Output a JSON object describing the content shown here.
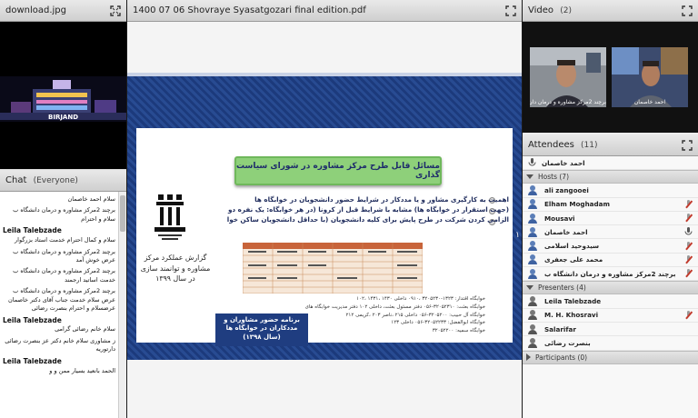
{
  "image_pod": {
    "title": "download.jpg",
    "caption": "BIRJAND"
  },
  "chat": {
    "title": "Chat",
    "audience": "(Everyone)",
    "messages": [
      {
        "author": "",
        "text": "سلام احمد خاصمان"
      },
      {
        "author": "",
        "text": "برچند 2مرکز مشاوره و درمان دانشگاه ب"
      },
      {
        "author": "",
        "text": "سلام و احترام"
      },
      {
        "author": "Leila Talebzade",
        "text": "سلام و کمال احترام خدمت استاد بزرگوار"
      },
      {
        "author": "",
        "text": "برچند 2مرکز مشاوره و درمان دانشگاه ب عرض خوش آمد"
      },
      {
        "author": "",
        "text": "برچند 2مرکز مشاوره و درمان دانشگاه ب خدمت اساتید ارجمند"
      },
      {
        "author": "",
        "text": "برچند 2مرکز مشاوره و درمان دانشگاه ب عرض سلام خدمت جناب آقای دکتر خاصمان"
      },
      {
        "author": "",
        "text": "عرضسلام و احترام بنصرت رضائی"
      },
      {
        "author": "Leila Talebzade",
        "text": "سلام خانم رضائی گرامی"
      },
      {
        "author": "",
        "text": "ز مشاوری سلام خانم دکتر عز بنصرت رضائی دارتوریه"
      },
      {
        "author": "Leila Talebzade",
        "text": "الحمد بانعید بسیار ممن و و"
      }
    ]
  },
  "share": {
    "title": "1400 07 06 Shovraye Syasatgozari final edition.pdf",
    "slide": {
      "green_title": "مسائل قابل طرح مرکز مشاوره در شورای سیاست گذاری",
      "bullets": [
        "اهمیت به کارگیری مشاور و یا مددکار در شرایط حضور دانشجویان در خوابگاه ها",
        "(جهت استقرار در خوابگاه ها) مشابه با شرایط قبل از کرونا (در هر خوابگاه: یک نفره دو روز در هفته)",
        "الزامی کردن شرکت در طرح پایش برای کلیه دانشجویان (با حداقل دانشجویان ساکن خوابگاه)"
      ],
      "report_lines": [
        "گزارش عملکرد مرکز",
        "مشاوره و توانمند سازی",
        "در سال ۱۳۹۹"
      ],
      "blue_box": [
        "برنامه حضور مشاوران و",
        "مددکاران در خوابگاه ها",
        "(سال ۱۳۹۸)"
      ],
      "contact": [
        "خوابگاه اقتدار: ۱۳۲۳-۳۲۰۵۲۳۰ ،۰۹۱۰ داخلی ۱۴۳۰ ،۱۴۳۱ ،۱۰۲",
        "خوابگاه بعثت: ۳۲۰۵۲۳۱۰-۰۵۶ دفتر مسئول بعثت، داخلی ۱۰۲ دفتر مدیریت خوابگاه های",
        "خوابگاه آل حبیب: ۳۲۰۵۲۰۰-۰۵۶ داخلی ۲۱۵ ،ناصر ۲۰۳ ،کریمی ۲۱۲",
        "خوابگاه ابوالفضل: ۳۲۰۵۲۲۳۳-۰۵۶ داخلی ۱۲۳",
        "خوابگاه سمیه: ۳۲۰۵۲۲۰۰"
      ],
      "page_number": "۱"
    }
  },
  "video": {
    "title": "Video",
    "count": "(2)",
    "cameras": [
      {
        "label": "برچند 2مرکز مشاوره و درمان دان..."
      },
      {
        "label": "احمد خاصمان"
      }
    ]
  },
  "attendees": {
    "title": "Attendees",
    "count": "(11)",
    "top_user": "احمد خاصمان",
    "hosts_label": "Hosts",
    "hosts_count": "(7)",
    "hosts": [
      {
        "name": "ali zangooei"
      },
      {
        "name": "Elham Moghadam"
      },
      {
        "name": "Mousavi"
      },
      {
        "name": "احمد خاصمان"
      },
      {
        "name": "سیدوحید اسلامی"
      },
      {
        "name": "محمد علی جعفری"
      },
      {
        "name": "برچند 2مرکز مشاوره و درمان دانشگاه ب"
      }
    ],
    "presenters_label": "Presenters",
    "presenters_count": "(4)",
    "presenters": [
      {
        "name": "Leila Talebzade"
      },
      {
        "name": "M. H. Khosravi"
      },
      {
        "name": "Salarifar"
      },
      {
        "name": "بنصرت رضائی"
      }
    ],
    "participants_label": "Participants",
    "participants_count": "(0)"
  },
  "colors": {
    "slide_blue": "#1f3d80",
    "green_title_bg": "#8ed07a",
    "host_icon": "#3e62a1"
  }
}
